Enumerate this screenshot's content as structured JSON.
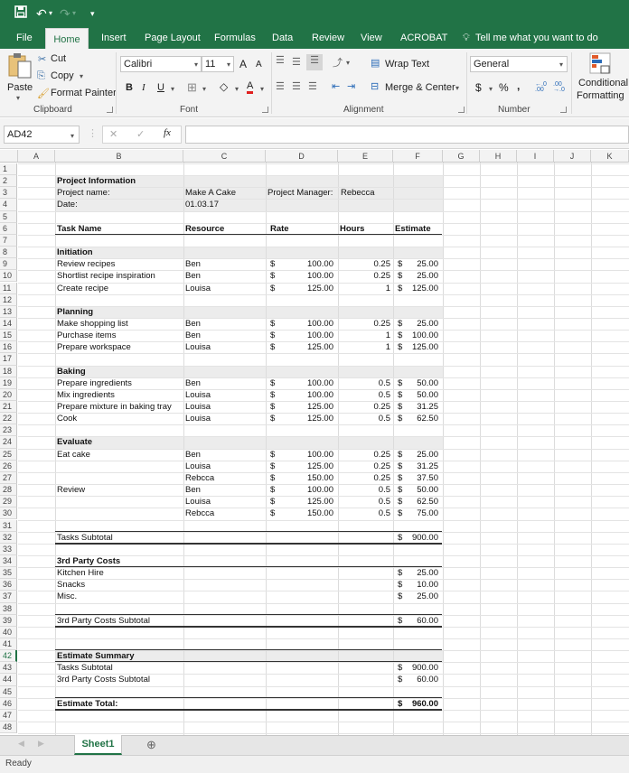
{
  "quick_access": {
    "save_icon": "💾",
    "undo_icon": "↶",
    "redo_icon": "↷",
    "customize_icon": "▾"
  },
  "tabs": [
    {
      "label": "File",
      "active": false
    },
    {
      "label": "Home",
      "active": true
    },
    {
      "label": "Insert",
      "active": false
    },
    {
      "label": "Page Layout",
      "active": false
    },
    {
      "label": "Formulas",
      "active": false
    },
    {
      "label": "Data",
      "active": false
    },
    {
      "label": "Review",
      "active": false
    },
    {
      "label": "View",
      "active": false
    },
    {
      "label": "ACROBAT",
      "active": false
    }
  ],
  "tell_me": "Tell me what you want to do",
  "ribbon": {
    "clipboard": {
      "paste": "Paste",
      "cut": "Cut",
      "copy": "Copy",
      "format_painter": "Format Painter",
      "label": "Clipboard"
    },
    "font": {
      "name": "Calibri",
      "size": "11",
      "bold": "B",
      "italic": "I",
      "underline": "U",
      "grow": "A",
      "shrink": "A",
      "label": "Font",
      "accent_color": "#e0201f"
    },
    "alignment": {
      "wrap_text": "Wrap Text",
      "merge_center": "Merge & Center",
      "label": "Alignment"
    },
    "number": {
      "format": "General",
      "currency": "$",
      "percent": "%",
      "comma": ",",
      "inc_decimal": "←.0 .00",
      "dec_decimal": ".00 →.0",
      "label": "Number"
    },
    "styles": {
      "conditional_line1": "Conditional",
      "conditional_line2": "Formatting"
    }
  },
  "formula_bar": {
    "name_box": "AD42",
    "cancel": "✕",
    "enter": "✓",
    "fx": "fx",
    "value": ""
  },
  "columns": [
    "A",
    "B",
    "C",
    "D",
    "E",
    "F",
    "G",
    "H",
    "I",
    "J",
    "K"
  ],
  "selected_row": 42,
  "rows": [
    {
      "n": 1
    },
    {
      "n": 2,
      "B": "Project Information",
      "bold": true
    },
    {
      "n": 3,
      "B": "Project name:",
      "C": "Make A Cake",
      "D": "Project Manager:",
      "E": "Rebecca"
    },
    {
      "n": 4,
      "B": "Date:",
      "C": "01.03.17"
    },
    {
      "n": 5
    },
    {
      "n": 6,
      "B": "Task Name",
      "C": "Resource",
      "D": "Rate",
      "E": "Hours",
      "F": "Estimate",
      "bold": true
    },
    {
      "n": 7
    },
    {
      "n": 8,
      "B": "Initiation",
      "bold": true
    },
    {
      "n": 9,
      "B": "Review recipes",
      "C": "Ben",
      "D": "100.00",
      "E": "0.25",
      "F": "25.00"
    },
    {
      "n": 10,
      "B": "Shortlist recipe inspiration",
      "C": "Ben",
      "D": "100.00",
      "E": "0.25",
      "F": "25.00"
    },
    {
      "n": 11,
      "B": "Create recipe",
      "C": "Louisa",
      "D": "125.00",
      "E": "1",
      "F": "125.00"
    },
    {
      "n": 12
    },
    {
      "n": 13,
      "B": "Planning",
      "bold": true
    },
    {
      "n": 14,
      "B": "Make shopping list",
      "C": "Ben",
      "D": "100.00",
      "E": "0.25",
      "F": "25.00"
    },
    {
      "n": 15,
      "B": "Purchase items",
      "C": "Ben",
      "D": "100.00",
      "E": "1",
      "F": "100.00"
    },
    {
      "n": 16,
      "B": "Prepare workspace",
      "C": "Louisa",
      "D": "125.00",
      "E": "1",
      "F": "125.00"
    },
    {
      "n": 17
    },
    {
      "n": 18,
      "B": "Baking",
      "bold": true
    },
    {
      "n": 19,
      "B": "Prepare ingredients",
      "C": "Ben",
      "D": "100.00",
      "E": "0.5",
      "F": "50.00"
    },
    {
      "n": 20,
      "B": "Mix ingredients",
      "C": "Louisa",
      "D": "100.00",
      "E": "0.5",
      "F": "50.00"
    },
    {
      "n": 21,
      "B": "Prepare mixture in baking tray",
      "C": "Louisa",
      "D": "125.00",
      "E": "0.25",
      "F": "31.25"
    },
    {
      "n": 22,
      "B": "Cook",
      "C": "Louisa",
      "D": "125.00",
      "E": "0.5",
      "F": "62.50"
    },
    {
      "n": 23
    },
    {
      "n": 24,
      "B": "Evaluate",
      "bold": true
    },
    {
      "n": 25,
      "B": "Eat cake",
      "C": "Ben",
      "D": "100.00",
      "E": "0.25",
      "F": "25.00"
    },
    {
      "n": 26,
      "C": "Louisa",
      "D": "125.00",
      "E": "0.25",
      "F": "31.25"
    },
    {
      "n": 27,
      "C": "Rebcca",
      "D": "150.00",
      "E": "0.25",
      "F": "37.50"
    },
    {
      "n": 28,
      "B": "Review",
      "C": "Ben",
      "D": "100.00",
      "E": "0.5",
      "F": "50.00"
    },
    {
      "n": 29,
      "C": "Louisa",
      "D": "125.00",
      "E": "0.5",
      "F": "62.50"
    },
    {
      "n": 30,
      "C": "Rebcca",
      "D": "150.00",
      "E": "0.5",
      "F": "75.00"
    },
    {
      "n": 31
    },
    {
      "n": 32,
      "B": "Tasks Subtotal",
      "F": "900.00"
    },
    {
      "n": 33
    },
    {
      "n": 34,
      "B": "3rd Party Costs",
      "bold": true
    },
    {
      "n": 35,
      "B": "Kitchen Hire",
      "F": "25.00"
    },
    {
      "n": 36,
      "B": "Snacks",
      "F": "10.00"
    },
    {
      "n": 37,
      "B": "Misc.",
      "F": "25.00"
    },
    {
      "n": 38
    },
    {
      "n": 39,
      "B": "3rd Party Costs Subtotal",
      "F": "60.00"
    },
    {
      "n": 40
    },
    {
      "n": 41
    },
    {
      "n": 42,
      "B": "Estimate Summary",
      "bold": true
    },
    {
      "n": 43,
      "B": "Tasks Subtotal",
      "F": "900.00"
    },
    {
      "n": 44,
      "B": "3rd Party Costs Subtotal",
      "F": "60.00"
    },
    {
      "n": 45
    },
    {
      "n": 46,
      "B": "Estimate Total:",
      "F": "960.00",
      "bold": true
    },
    {
      "n": 47
    },
    {
      "n": 48
    }
  ],
  "currency_symbol": "$",
  "sheet_tabs": [
    {
      "label": "Sheet1",
      "active": true
    }
  ],
  "add_sheet_icon": "⊕",
  "status": "Ready",
  "colors": {
    "brand": "#217346",
    "header_bg": "#f3f3f3",
    "shade": "#ececec"
  }
}
